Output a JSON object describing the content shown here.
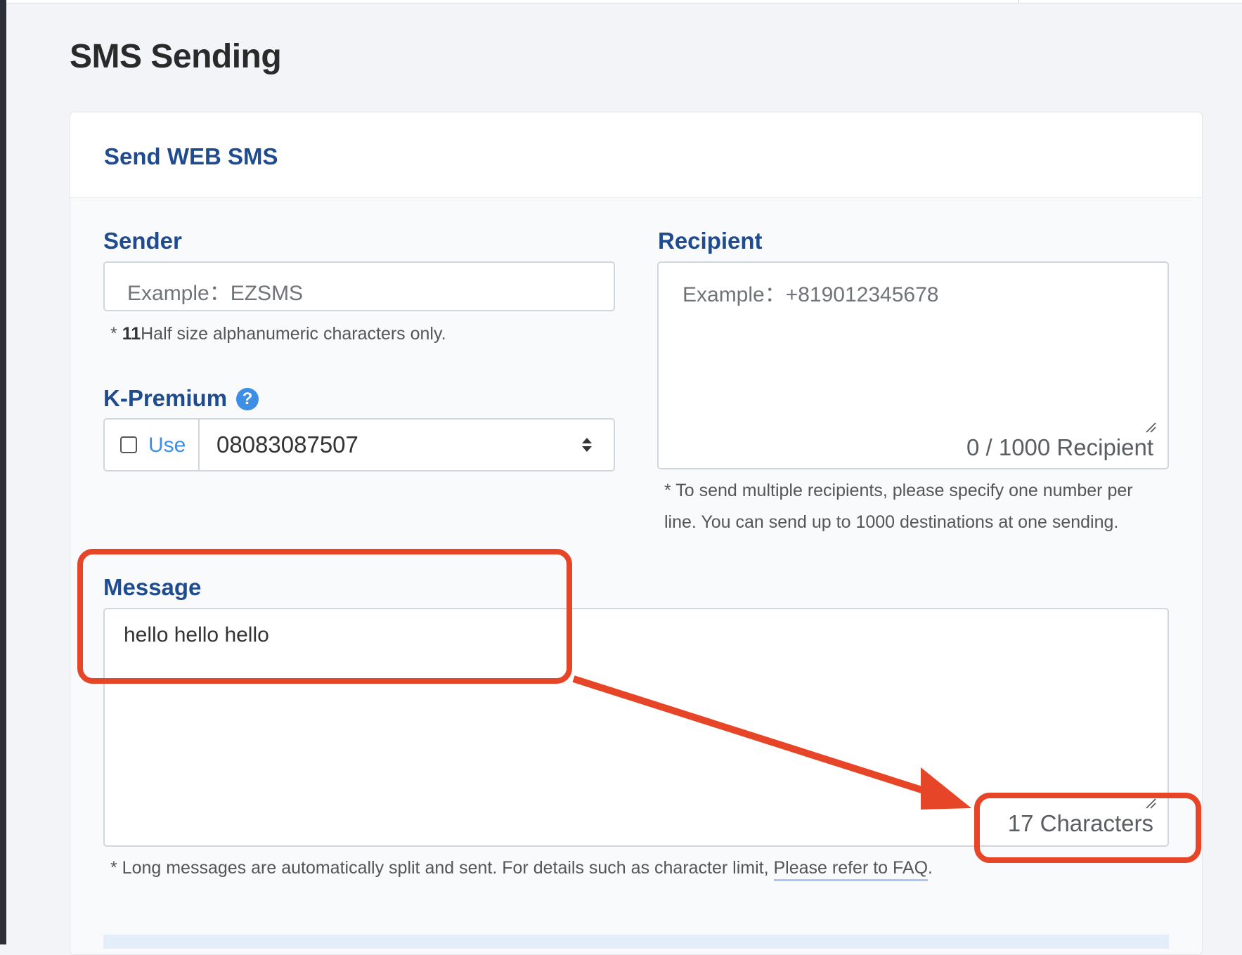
{
  "page": {
    "title": "SMS Sending"
  },
  "card": {
    "title": "Send WEB SMS"
  },
  "sender": {
    "label": "Sender",
    "placeholder": "Example：EZSMS",
    "hint_prefix": "* ",
    "hint_bold": "11",
    "hint_rest": "Half size alphanumeric characters only."
  },
  "kpremium": {
    "label": "K-Premium",
    "help_icon": "?",
    "use_label": "Use",
    "use_checked": false,
    "selected_number": "08083087507"
  },
  "recipient": {
    "label": "Recipient",
    "placeholder": "Example：+819012345678",
    "counter": "0 / 1000 Recipient",
    "hint_line1": "* To send multiple recipients, please specify one number per",
    "hint_line2": "line. You can send up to 1000 destinations at one sending."
  },
  "message": {
    "label": "Message",
    "value": "hello hello hello",
    "counter": "17 Characters",
    "hint_text": "* Long messages are automatically split and sent. For details such as character limit, ",
    "hint_link": "Please refer to FAQ",
    "hint_end": "."
  },
  "annotation": {
    "color": "#e64528"
  },
  "colors": {
    "accent": "#1f4b8f",
    "link": "#3d8fe6",
    "background": "#f3f4f7"
  }
}
